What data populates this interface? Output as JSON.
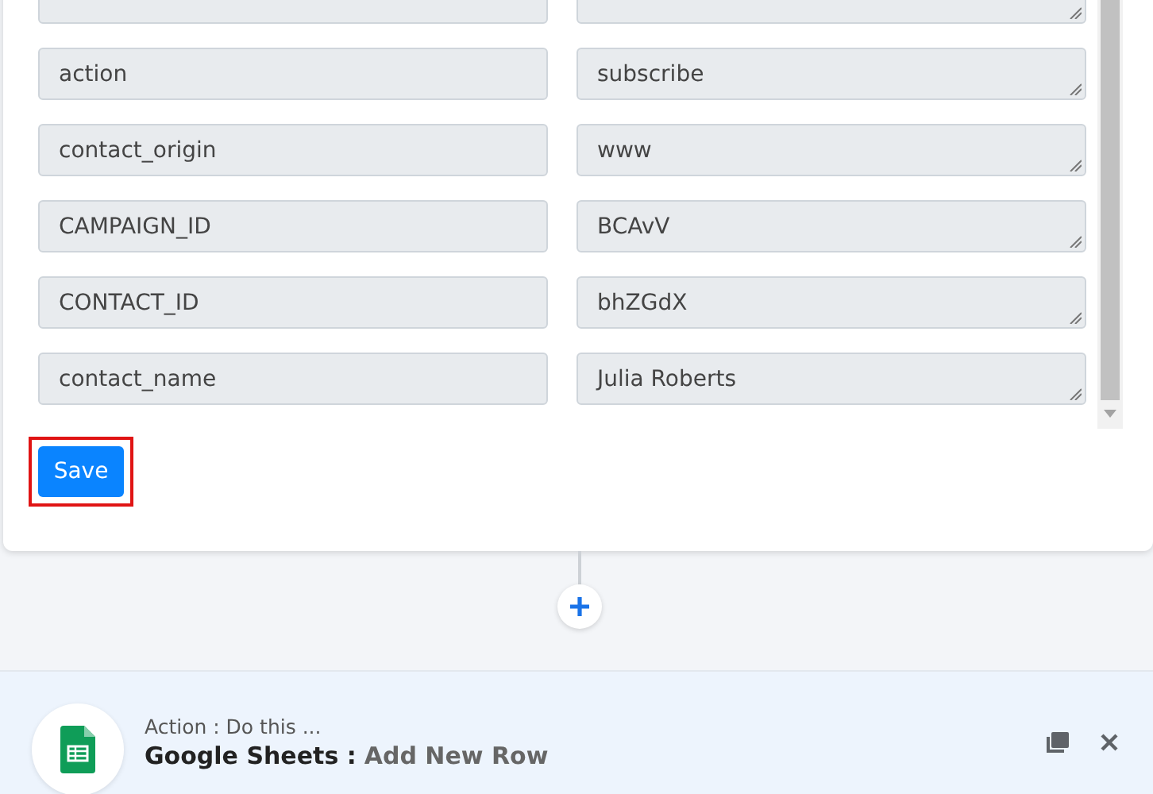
{
  "mapping_rows": [
    {
      "name": "",
      "value": ""
    },
    {
      "name": "action",
      "value": "subscribe"
    },
    {
      "name": "contact_origin",
      "value": "www"
    },
    {
      "name": "CAMPAIGN_ID",
      "value": "BCAvV"
    },
    {
      "name": "CONTACT_ID",
      "value": "bhZGdX"
    },
    {
      "name": "contact_name",
      "value": "Julia Roberts"
    }
  ],
  "save_button": {
    "label": "Save",
    "highlighted": true
  },
  "action_step": {
    "caption": "Action : Do this ...",
    "app": "Google Sheets :",
    "event": "Add New Row"
  }
}
